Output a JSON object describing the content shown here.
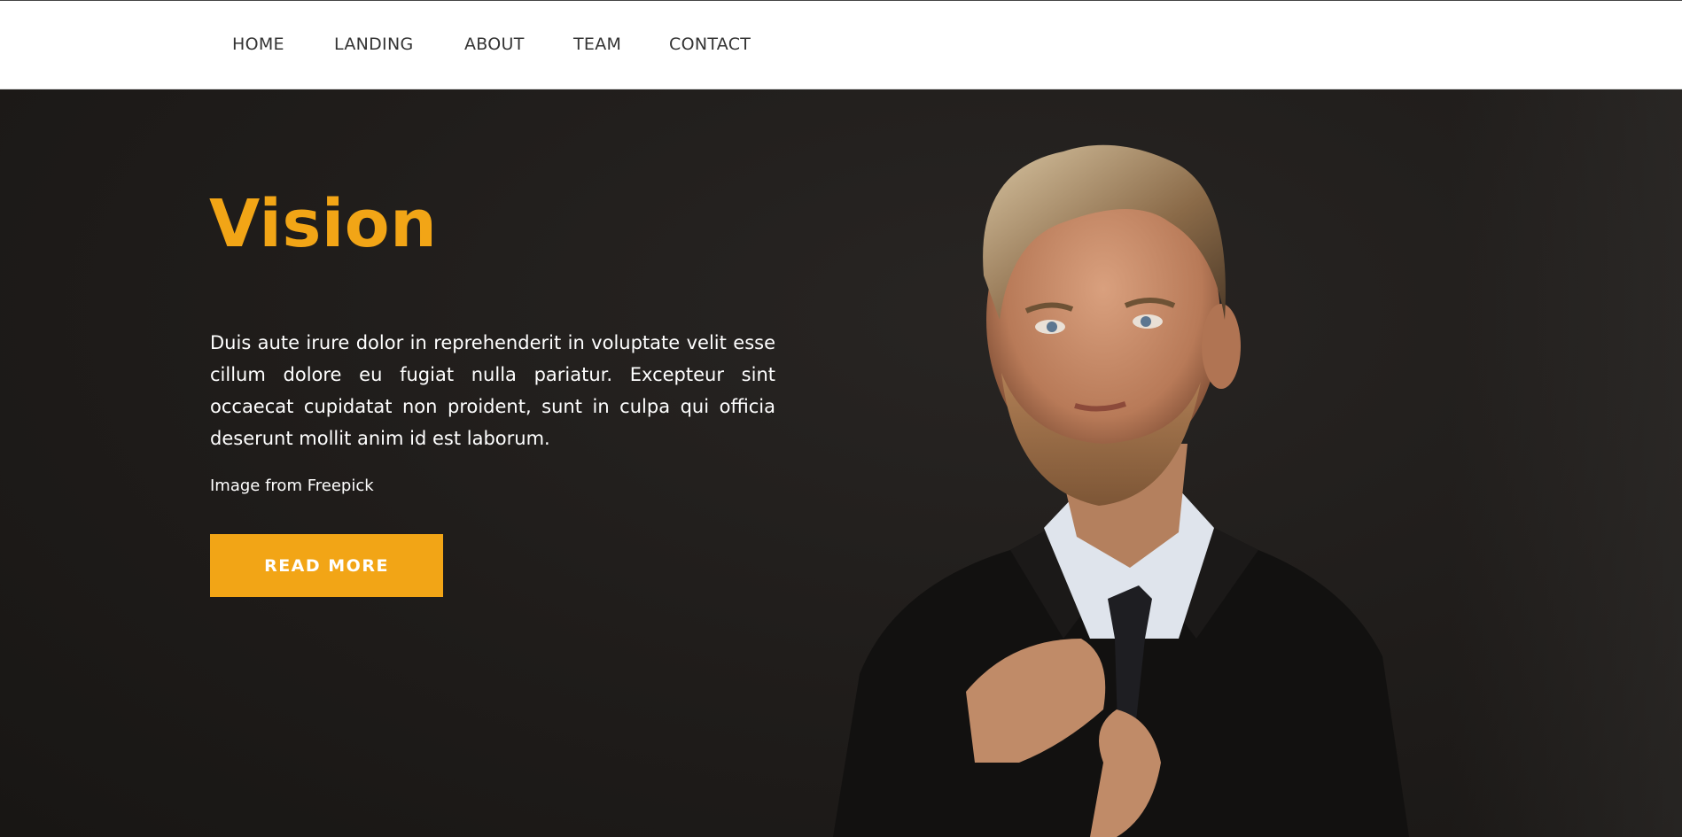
{
  "nav": {
    "items": [
      {
        "label": "HOME"
      },
      {
        "label": "LANDING"
      },
      {
        "label": "ABOUT"
      },
      {
        "label": "TEAM"
      },
      {
        "label": "CONTACT"
      }
    ]
  },
  "hero": {
    "title": "Vision",
    "body": "Duis aute irure dolor in reprehenderit in voluptate velit esse cillum dolore eu fugiat nulla pariatur. Excepteur sint occaecat cupidatat non proident, sunt in culpa qui officia deserunt mollit anim id est laborum.",
    "credit": "Image from Freepick",
    "button_label": "READ MORE"
  },
  "colors": {
    "accent": "#f2a516",
    "hero_background": "#1f1c1a",
    "navbar_background": "#ffffff"
  }
}
